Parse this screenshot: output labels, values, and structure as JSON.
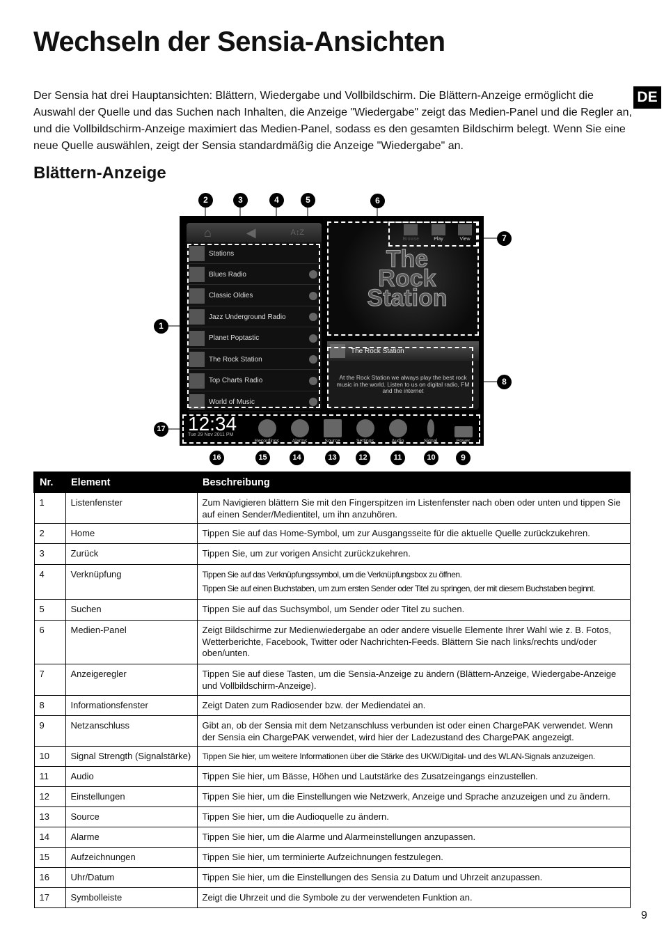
{
  "title": "Wechseln der Sensia-Ansichten",
  "lang_badge": "DE",
  "intro": "Der Sensia hat drei Hauptansichten: Blättern, Wiedergabe und Vollbildschirm. Die Blättern-Anzeige ermöglicht die Auswahl der Quelle und das Suchen nach Inhalten, die Anzeige \"Wiedergabe\" zeigt das Medien-Panel und die Regler an, und die Vollbildschirm-Anzeige maximiert das Medien-Panel, sodass es den gesamten Bildschirm belegt. Wenn Sie eine neue Quelle auswählen, zeigt der Sensia standardmäßig die Anzeige \"Wiedergabe\" an.",
  "subtitle": "Blättern-Anzeige",
  "device": {
    "list_header": "Stations",
    "stations": [
      "Blues Radio",
      "Classic Oldies",
      "Jazz Underground Radio",
      "Planet Poptastic",
      "The Rock Station",
      "Top Charts Radio",
      "World of Music"
    ],
    "media_logo": "The Rock Station",
    "view_controls": [
      "Browse",
      "Play",
      "View"
    ],
    "info_title": "The Rock Station",
    "info_text": "At the Rock Station we always play the best rock music in the world. Listen to us on digital radio, FM and the internet",
    "time": "12:34",
    "date": "Tue 29 Nov 2011 PM",
    "toolbar": [
      "Recordings",
      "Alarms",
      "Source",
      "Settings",
      "Audio",
      "Signal",
      "Power"
    ]
  },
  "callouts": [
    "1",
    "2",
    "3",
    "4",
    "5",
    "6",
    "7",
    "8",
    "9",
    "10",
    "11",
    "12",
    "13",
    "14",
    "15",
    "16",
    "17"
  ],
  "table": {
    "headers": [
      "Nr.",
      "Element",
      "Beschreibung"
    ],
    "rows": [
      [
        "1",
        "Listenfenster",
        "Zum Navigieren blättern Sie mit den Fingerspitzen im Listenfenster nach oben oder unten und tippen Sie auf einen Sender/Medientitel, um ihn anzuhören."
      ],
      [
        "2",
        "Home",
        "Tippen Sie auf das Home-Symbol, um zur Ausgangsseite für die aktuelle Quelle zurückzukehren."
      ],
      [
        "3",
        "Zurück",
        "Tippen Sie, um zur vorigen Ansicht zurückzukehren."
      ],
      [
        "4",
        "Verknüpfung",
        "Tippen Sie auf das Verknüpfungssymbol, um die Verknüpfungsbox zu öffnen.",
        "Tippen Sie auf einen Buchstaben, um zum ersten Sender oder Titel zu springen, der mit diesem Buchstaben beginnt."
      ],
      [
        "5",
        "Suchen",
        "Tippen Sie auf das Suchsymbol, um Sender oder Titel zu suchen."
      ],
      [
        "6",
        "Medien-Panel",
        "Zeigt Bildschirme zur Medienwiedergabe an oder andere visuelle Elemente Ihrer Wahl wie z. B. Fotos, Wetterberichte, Facebook, Twitter oder Nachrichten-Feeds. Blättern Sie nach links/rechts und/oder oben/unten."
      ],
      [
        "7",
        "Anzeigeregler",
        "Tippen Sie auf diese Tasten, um die Sensia-Anzeige zu ändern (Blättern-Anzeige, Wiedergabe-Anzeige und Vollbildschirm-Anzeige)."
      ],
      [
        "8",
        "Informationsfenster",
        "Zeigt Daten zum Radiosender bzw. der Mediendatei an."
      ],
      [
        "9",
        "Netzanschluss",
        "Gibt an, ob der Sensia mit dem Netzanschluss verbunden ist oder einen ChargePAK verwendet. Wenn der Sensia ein ChargePAK verwendet, wird hier der Ladezustand des ChargePAK angezeigt."
      ],
      [
        "10",
        "Signal Strength (Signalstärke)",
        "Tippen Sie hier, um weitere Informationen über die Stärke des UKW/Digital- und des WLAN-Signals anzuzeigen."
      ],
      [
        "11",
        "Audio",
        "Tippen Sie hier, um Bässe, Höhen und Lautstärke des Zusatzeingangs einzustellen."
      ],
      [
        "12",
        "Einstellungen",
        "Tippen Sie hier, um die Einstellungen wie Netzwerk, Anzeige und Sprache anzuzeigen und zu ändern."
      ],
      [
        "13",
        "Source",
        "Tippen Sie hier, um die Audioquelle zu ändern."
      ],
      [
        "14",
        "Alarme",
        "Tippen Sie hier, um die Alarme und Alarmeinstellungen anzupassen."
      ],
      [
        "15",
        "Aufzeichnungen",
        "Tippen Sie hier, um terminierte Aufzeichnungen festzulegen."
      ],
      [
        "16",
        "Uhr/Datum",
        "Tippen Sie hier, um die Einstellungen des Sensia zu Datum und Uhrzeit anzupassen."
      ],
      [
        "17",
        "Symbolleiste",
        "Zeigt die Uhrzeit und die Symbole zu der verwendeten Funktion an."
      ]
    ]
  },
  "page_number": "9"
}
